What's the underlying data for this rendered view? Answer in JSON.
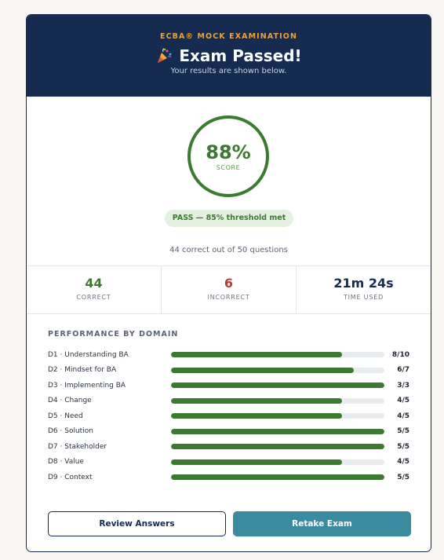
{
  "header": {
    "eyebrow": "ECBA® MOCK EXAMINATION",
    "title": "Exam Passed!",
    "subtitle": "Your results are shown below.",
    "icon": "party-popper-icon"
  },
  "score": {
    "value": "88%",
    "label": "SCORE",
    "pass_text": "PASS — 85% threshold met",
    "summary": "44 correct out of 50 questions"
  },
  "stats": [
    {
      "value": "44",
      "label": "CORRECT",
      "color": "#3d7a31"
    },
    {
      "value": "6",
      "label": "INCORRECT",
      "color": "#c0392b"
    },
    {
      "value": "21m 24s",
      "label": "TIME USED",
      "color": "#152b4f"
    }
  ],
  "performance": {
    "title": "PERFORMANCE BY DOMAIN",
    "domains": [
      {
        "name": "D1 · Understanding BA",
        "score": "8/10",
        "fraction": 0.8
      },
      {
        "name": "D2 · Mindset for BA",
        "score": "6/7",
        "fraction": 0.857
      },
      {
        "name": "D3 · Implementing BA",
        "score": "3/3",
        "fraction": 1.0
      },
      {
        "name": "D4 · Change",
        "score": "4/5",
        "fraction": 0.8
      },
      {
        "name": "D5 · Need",
        "score": "4/5",
        "fraction": 0.8
      },
      {
        "name": "D6 · Solution",
        "score": "5/5",
        "fraction": 1.0
      },
      {
        "name": "D7 · Stakeholder",
        "score": "5/5",
        "fraction": 1.0
      },
      {
        "name": "D8 · Value",
        "score": "4/5",
        "fraction": 0.8
      },
      {
        "name": "D9 · Context",
        "score": "5/5",
        "fraction": 1.0
      }
    ]
  },
  "actions": {
    "review_label": "Review Answers",
    "retake_label": "Retake Exam"
  },
  "colors": {
    "header_bg": "#152b4f",
    "accent": "#e9a23b",
    "success": "#3d7a31",
    "error": "#c0392b",
    "primary_button": "#3a8aa0"
  }
}
